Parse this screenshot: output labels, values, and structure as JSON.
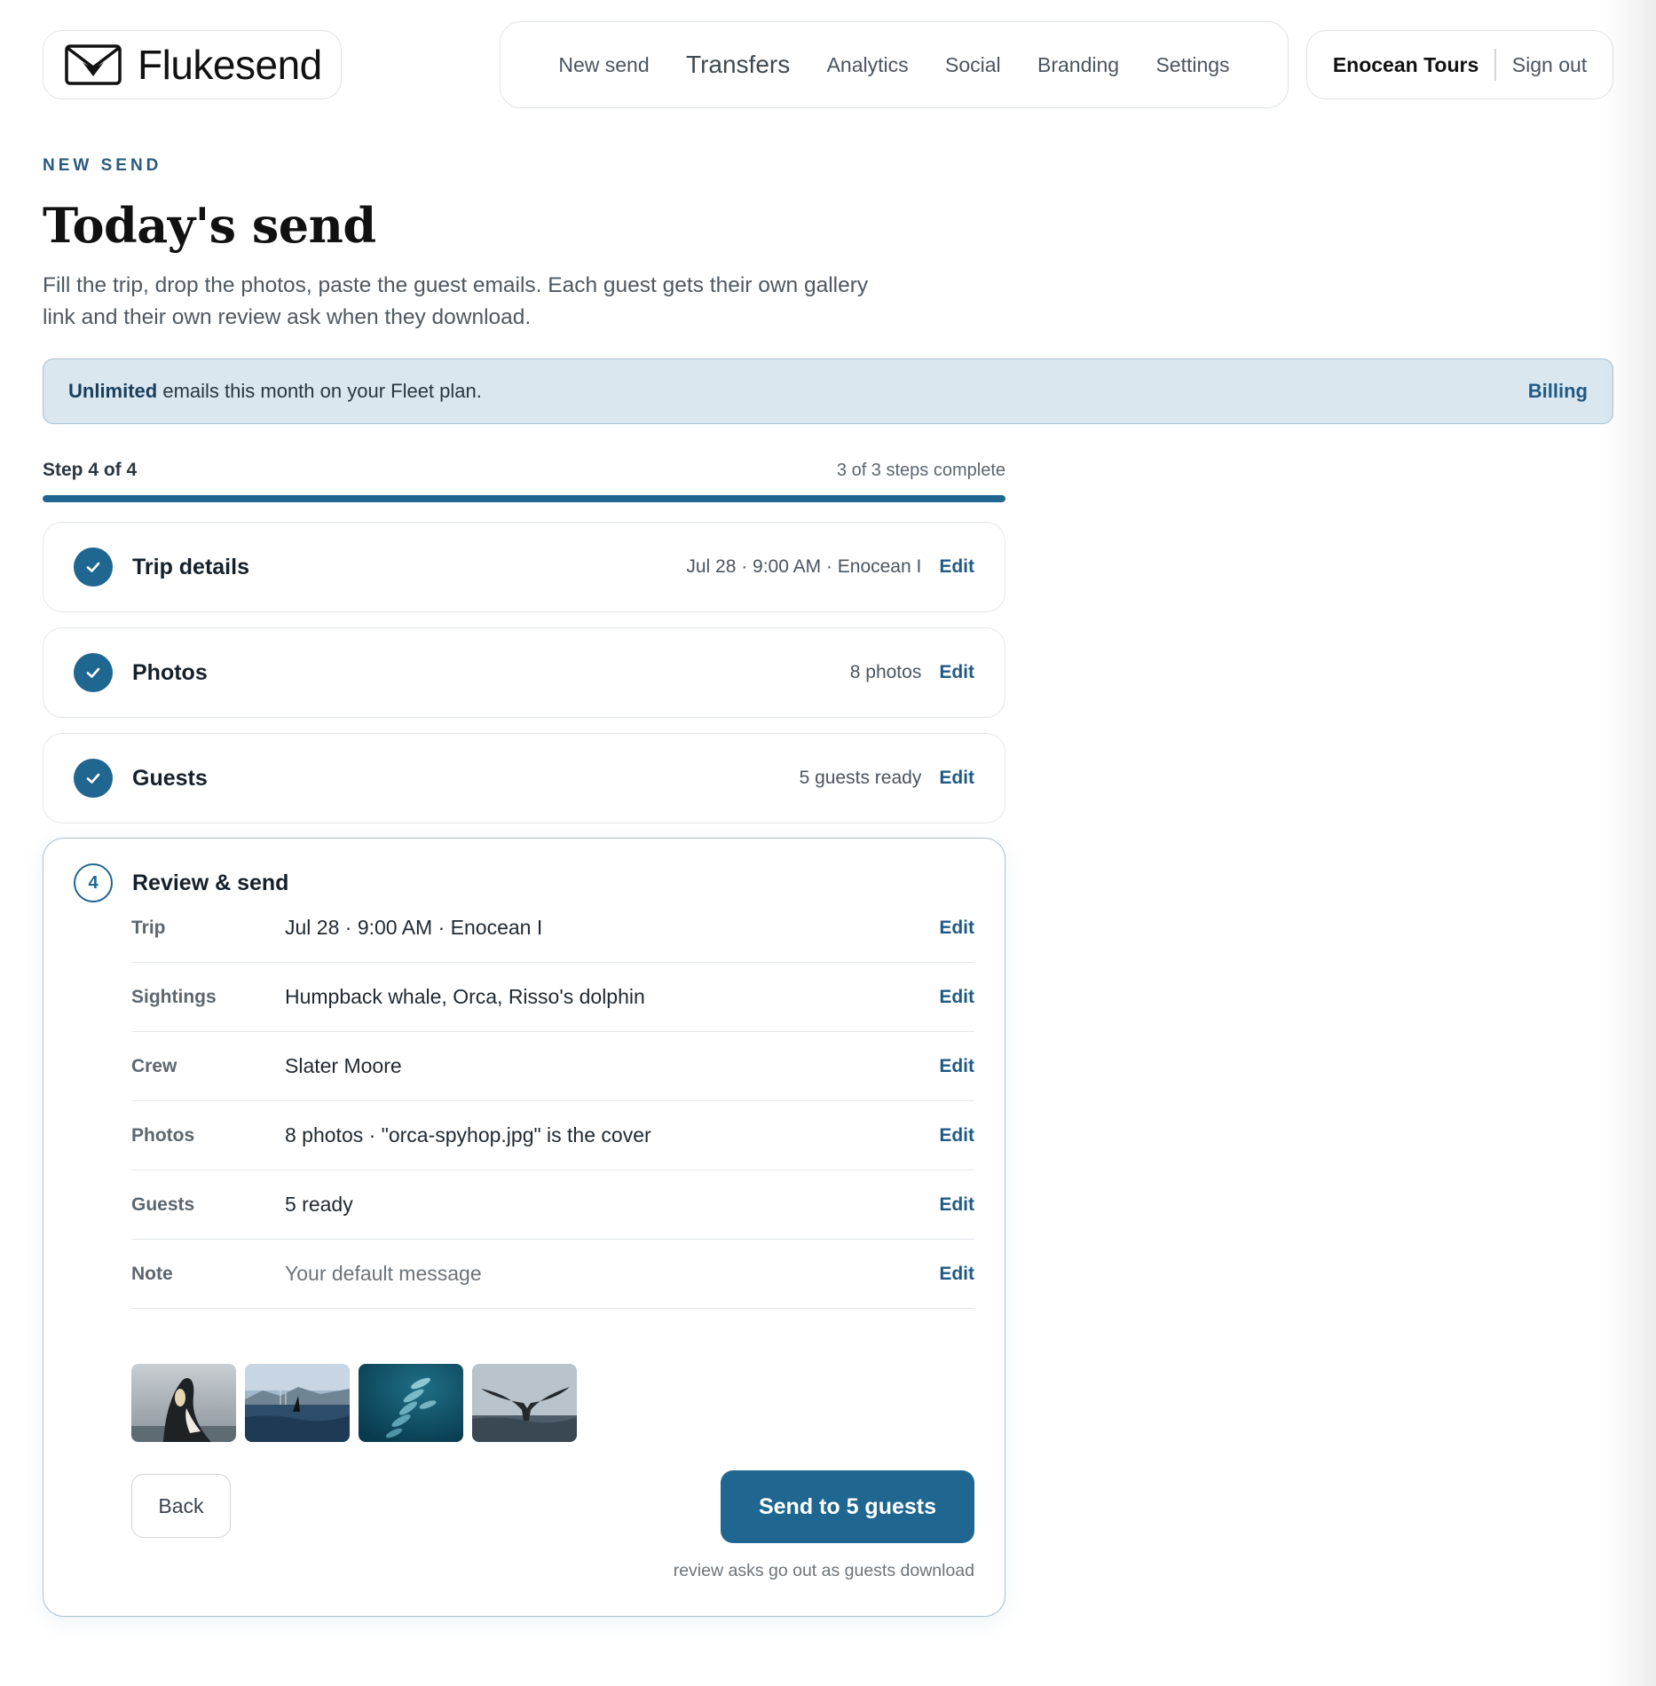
{
  "brand": {
    "name": "Flukesend",
    "logo_icon": "envelope-fluke-icon"
  },
  "nav": {
    "items": [
      {
        "label": "New send"
      },
      {
        "label": "Transfers"
      },
      {
        "label": "Analytics"
      },
      {
        "label": "Social"
      },
      {
        "label": "Branding"
      },
      {
        "label": "Settings"
      }
    ]
  },
  "account": {
    "name": "Enocean Tours",
    "sign_out": "Sign out"
  },
  "heading": {
    "eyebrow": "NEW SEND",
    "title": "Today's send",
    "description": "Fill the trip, drop the photos, paste the guest emails. Each guest gets their own gallery link and their own review ask when they download."
  },
  "banner": {
    "strong": "Unlimited",
    "text": " emails this month on your Fleet plan.",
    "link": "Billing"
  },
  "progress": {
    "step_label": "Step 4 of 4",
    "count_label": "3 of 3 steps complete",
    "fraction": 1.0
  },
  "steps": [
    {
      "title": "Trip details",
      "summary": "Jul 28 · 9:00 AM · Enocean I",
      "edit": "Edit",
      "status": "complete"
    },
    {
      "title": "Photos",
      "summary": "8 photos",
      "edit": "Edit",
      "status": "complete"
    },
    {
      "title": "Guests",
      "summary": "5 guests ready",
      "edit": "Edit",
      "status": "complete"
    }
  ],
  "review": {
    "number": "4",
    "title": "Review & send",
    "rows": [
      {
        "label": "Trip",
        "value": "Jul 28 · 9:00 AM · Enocean I",
        "edit": "Edit"
      },
      {
        "label": "Sightings",
        "value": "Humpback whale, Orca, Risso's dolphin",
        "edit": "Edit"
      },
      {
        "label": "Crew",
        "value": "Slater Moore",
        "edit": "Edit"
      },
      {
        "label": "Photos",
        "value": "8 photos · \"orca-spyhop.jpg\" is the cover",
        "edit": "Edit"
      },
      {
        "label": "Guests",
        "value": "5 ready",
        "edit": "Edit"
      },
      {
        "label": "Note",
        "value": "Your default message",
        "edit": "Edit"
      }
    ],
    "thumbnails": [
      "orca-spyhop-photo",
      "orca-fin-photo",
      "dolphins-underwater-photo",
      "whale-fluke-photo"
    ],
    "back_label": "Back",
    "send_label": "Send to 5 guests",
    "send_hint": "review asks go out as guests download"
  },
  "colors": {
    "accent": "#1f6690",
    "link": "#1f5a85",
    "banner_bg": "#dbe7ef",
    "banner_border": "#a7c2d4"
  }
}
